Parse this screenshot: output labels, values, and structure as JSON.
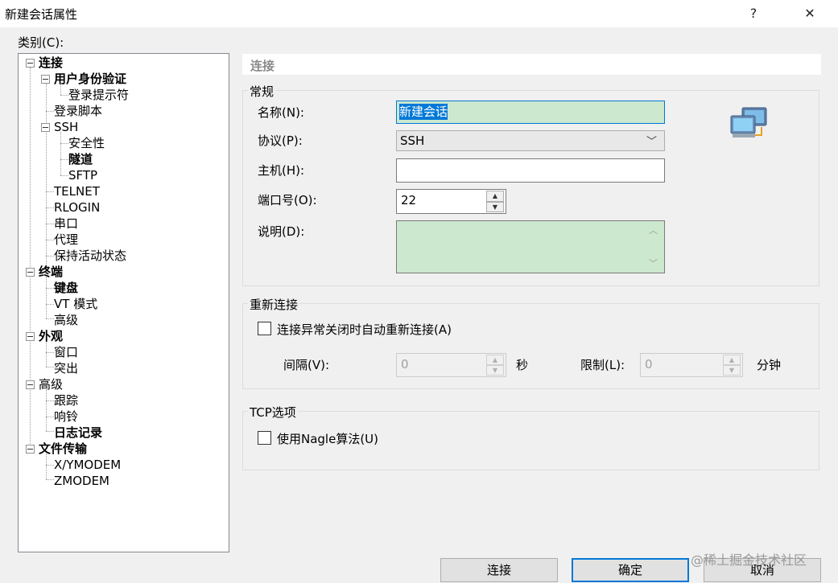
{
  "window": {
    "title": "新建会话属性",
    "help_label": "?",
    "close_label": "✕"
  },
  "category_label": "类别(C):",
  "tree": [
    {
      "label": "连接",
      "bold": true
    },
    {
      "label": "用户身份验证",
      "bold": true
    },
    {
      "label": "登录提示符",
      "bold": false
    },
    {
      "label": "登录脚本",
      "bold": false
    },
    {
      "label": "SSH",
      "bold": false
    },
    {
      "label": "安全性",
      "bold": false
    },
    {
      "label": "隧道",
      "bold": true
    },
    {
      "label": "SFTP",
      "bold": false
    },
    {
      "label": "TELNET",
      "bold": false
    },
    {
      "label": "RLOGIN",
      "bold": false
    },
    {
      "label": "串口",
      "bold": false
    },
    {
      "label": "代理",
      "bold": false
    },
    {
      "label": "保持活动状态",
      "bold": false
    },
    {
      "label": "终端",
      "bold": true
    },
    {
      "label": "键盘",
      "bold": true
    },
    {
      "label": "VT 模式",
      "bold": false
    },
    {
      "label": "高级",
      "bold": false
    },
    {
      "label": "外观",
      "bold": true
    },
    {
      "label": "窗口",
      "bold": false
    },
    {
      "label": "突出",
      "bold": false
    },
    {
      "label": "高级",
      "bold": false
    },
    {
      "label": "跟踪",
      "bold": false
    },
    {
      "label": "响铃",
      "bold": false
    },
    {
      "label": "日志记录",
      "bold": true
    },
    {
      "label": "文件传输",
      "bold": true
    },
    {
      "label": "X/YMODEM",
      "bold": false
    },
    {
      "label": "ZMODEM",
      "bold": false
    }
  ],
  "panel": {
    "header": "连接",
    "general": {
      "title": "常规",
      "name_label": "名称(N):",
      "name_value": "新建会话",
      "protocol_label": "协议(P):",
      "protocol_value": "SSH",
      "host_label": "主机(H):",
      "host_value": "",
      "port_label": "端口号(O):",
      "port_value": "22",
      "desc_label": "说明(D):",
      "desc_value": ""
    },
    "reconnect": {
      "title": "重新连接",
      "checkbox_label": "连接异常关闭时自动重新连接(A)",
      "checked": false,
      "interval_label": "间隔(V):",
      "interval_value": "0",
      "interval_unit": "秒",
      "limit_label": "限制(L):",
      "limit_value": "0",
      "limit_unit": "分钟"
    },
    "tcp": {
      "title": "TCP选项",
      "nagle_label": "使用Nagle算法(U)",
      "checked": false
    }
  },
  "buttons": {
    "connect": "连接",
    "ok": "确定",
    "cancel": "取消"
  },
  "watermark": "@稀土掘金技术社区"
}
